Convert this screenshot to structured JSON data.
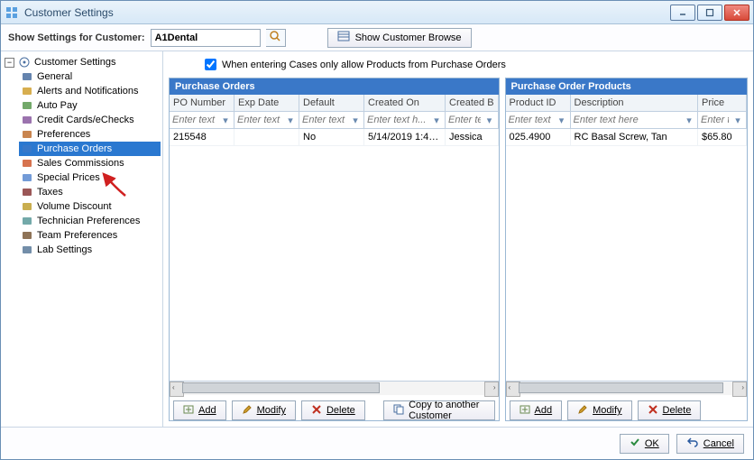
{
  "window": {
    "title": "Customer Settings"
  },
  "topbar": {
    "label": "Show Settings for Customer:",
    "customer_value": "A1Dental",
    "browse_label": "Show Customer Browse"
  },
  "tree": {
    "root": "Customer Settings",
    "items": [
      {
        "label": "General"
      },
      {
        "label": "Alerts and Notifications"
      },
      {
        "label": "Auto Pay"
      },
      {
        "label": "Credit Cards/eChecks"
      },
      {
        "label": "Preferences"
      },
      {
        "label": "Purchase Orders",
        "selected": true
      },
      {
        "label": "Sales Commissions"
      },
      {
        "label": "Special Prices"
      },
      {
        "label": "Taxes"
      },
      {
        "label": "Volume Discount"
      },
      {
        "label": "Technician Preferences"
      },
      {
        "label": "Team Preferences"
      },
      {
        "label": "Lab Settings"
      }
    ]
  },
  "checkbox": {
    "label": "When entering Cases only allow Products from Purchase Orders"
  },
  "po": {
    "title": "Purchase Orders",
    "cols": [
      "PO Number",
      "Exp Date",
      "Default",
      "Created On",
      "Created B"
    ],
    "filter_placeholder": "Enter text here",
    "filter_placeholder_short": "Enter text h...",
    "rows": [
      {
        "po_number": "215548",
        "exp_date": "",
        "default": "No",
        "created_on": "5/14/2019 1:47...",
        "created_by": "Jessica"
      }
    ]
  },
  "pp": {
    "title": "Purchase Order Products",
    "cols": [
      "Product ID",
      "Description",
      "Price"
    ],
    "filter_placeholder": "Enter text here",
    "filter_placeholder_short": "Enter te...",
    "rows": [
      {
        "product_id": "025.4900",
        "description": "RC Basal Screw, Tan",
        "price": "$65.80"
      }
    ]
  },
  "buttons": {
    "add": "Add",
    "modify": "Modify",
    "delete": "Delete",
    "copy": "Copy to another Customer",
    "ok": "OK",
    "cancel": "Cancel"
  }
}
